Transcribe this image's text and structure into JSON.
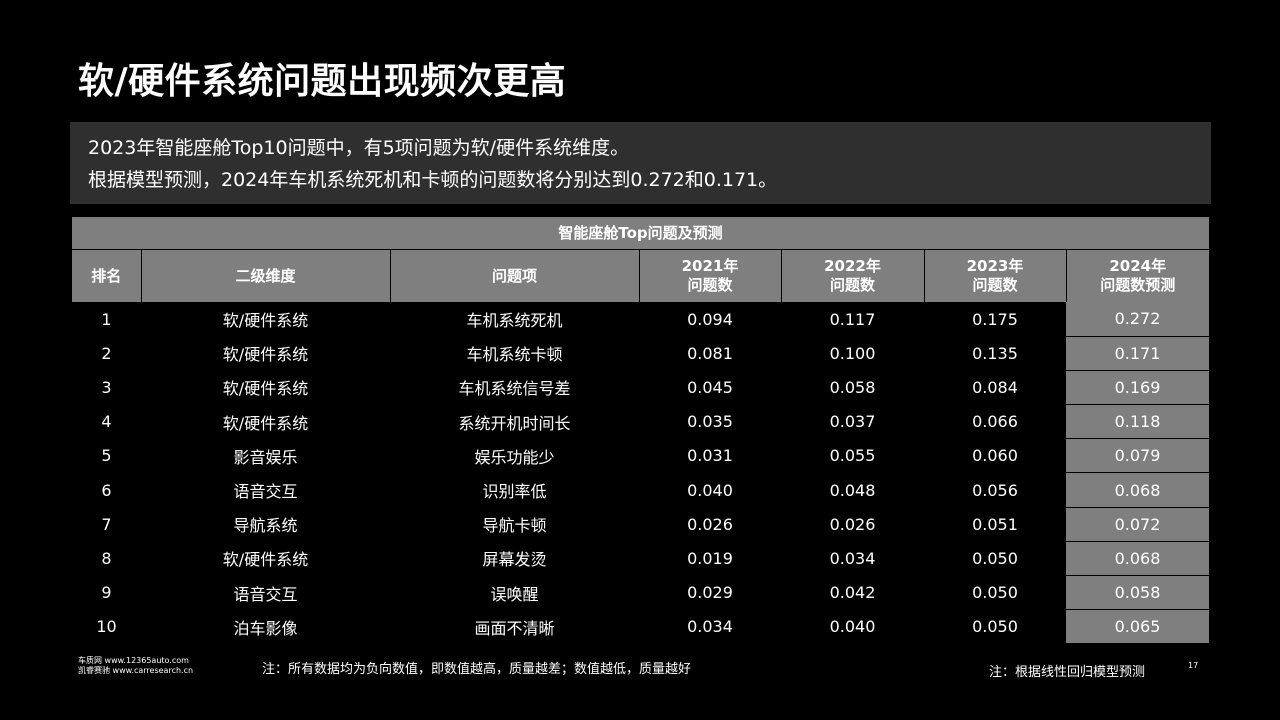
{
  "title": "软/硬件系统问题出现频次更高",
  "summary": {
    "line1": "2023年智能座舱Top10问题中，有5项问题为软/硬件系统维度。",
    "line2": "根据模型预测，2024年车机系统死机和卡顿的问题数将分别达到0.272和0.171。"
  },
  "table": {
    "caption": "智能座舱Top问题及预测",
    "headers": {
      "rank": "排名",
      "dimension": "二级维度",
      "item": "问题项",
      "y2021": [
        "2021年",
        "问题数"
      ],
      "y2022": [
        "2022年",
        "问题数"
      ],
      "y2023": [
        "2023年",
        "问题数"
      ],
      "y2024": [
        "2024年",
        "问题数预测"
      ]
    },
    "rows": [
      {
        "rank": "1",
        "dimension": "软/硬件系统",
        "item": "车机系统死机",
        "y2021": "0.094",
        "y2022": "0.117",
        "y2023": "0.175",
        "y2024": "0.272"
      },
      {
        "rank": "2",
        "dimension": "软/硬件系统",
        "item": "车机系统卡顿",
        "y2021": "0.081",
        "y2022": "0.100",
        "y2023": "0.135",
        "y2024": "0.171"
      },
      {
        "rank": "3",
        "dimension": "软/硬件系统",
        "item": "车机系统信号差",
        "y2021": "0.045",
        "y2022": "0.058",
        "y2023": "0.084",
        "y2024": "0.169"
      },
      {
        "rank": "4",
        "dimension": "软/硬件系统",
        "item": "系统开机时间长",
        "y2021": "0.035",
        "y2022": "0.037",
        "y2023": "0.066",
        "y2024": "0.118"
      },
      {
        "rank": "5",
        "dimension": "影音娱乐",
        "item": "娱乐功能少",
        "y2021": "0.031",
        "y2022": "0.055",
        "y2023": "0.060",
        "y2024": "0.079"
      },
      {
        "rank": "6",
        "dimension": "语音交互",
        "item": "识别率低",
        "y2021": "0.040",
        "y2022": "0.048",
        "y2023": "0.056",
        "y2024": "0.068"
      },
      {
        "rank": "7",
        "dimension": "导航系统",
        "item": "导航卡顿",
        "y2021": "0.026",
        "y2022": "0.026",
        "y2023": "0.051",
        "y2024": "0.072"
      },
      {
        "rank": "8",
        "dimension": "软/硬件系统",
        "item": "屏幕发烫",
        "y2021": "0.019",
        "y2022": "0.034",
        "y2023": "0.050",
        "y2024": "0.068"
      },
      {
        "rank": "9",
        "dimension": "语音交互",
        "item": "误唤醒",
        "y2021": "0.029",
        "y2022": "0.042",
        "y2023": "0.050",
        "y2024": "0.058"
      },
      {
        "rank": "10",
        "dimension": "泊车影像",
        "item": "画面不清晰",
        "y2021": "0.034",
        "y2022": "0.040",
        "y2023": "0.050",
        "y2024": "0.065"
      }
    ]
  },
  "footer": {
    "source_line1": "车质网 www.12365auto.com",
    "source_line2": "凯睿赛驰 www.carresearch.cn",
    "note_left": "注：所有数据均为负向数值，即数值越高，质量越差；数值越低，质量越好",
    "note_right": "注：根据线性回归模型预测",
    "page_number": "17"
  },
  "colors": {
    "background": "#000000",
    "header_gray": "#7f7f7f",
    "summary_bg": "#2f2f2f",
    "text": "#ffffff"
  }
}
